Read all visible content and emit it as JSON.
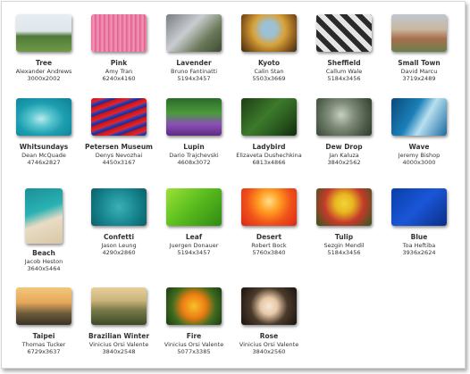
{
  "wallpapers": [
    {
      "name": "Tree",
      "author": "Alexander Andrews",
      "dims": "3000x2002",
      "bg": "linear-gradient(180deg,#e6eef4 0%,#dfe7ec 45%,#4f7a3a 58%,#6f9a46 100%)"
    },
    {
      "name": "Pink",
      "author": "Amy Tran",
      "dims": "6240x4160",
      "bg": "repeating-linear-gradient(90deg,#e86a97 0px,#f39ab9 3px,#d65485 5px)"
    },
    {
      "name": "Lavender",
      "author": "Bruno Fantinatti",
      "dims": "5194x3457",
      "bg": "linear-gradient(135deg,#7a7d84 0%,#c9cdd1 40%,#6c7a5a 70%,#3d4a32 100%)"
    },
    {
      "name": "Kyoto",
      "author": "Calin Stan",
      "dims": "5503x3669",
      "bg": "radial-gradient(circle at 50% 40%,#9cc1d6 0%,#9cc1d6 20%,#d9a23a 45%,#8a5a1c 75%,#3a2a12 100%)"
    },
    {
      "name": "Sheffield",
      "author": "Callum Wale",
      "dims": "5184x3456",
      "bg": "repeating-linear-gradient(45deg,#2a2a2a 0px,#2a2a2a 6px,#e5e5e5 6px,#e5e5e5 12px)"
    },
    {
      "name": "Small Town",
      "author": "David Marcu",
      "dims": "3719x2489",
      "bg": "linear-gradient(180deg,#bfc8cf 0%,#c9b7a0 40%,#a86f4e 65%,#6a7f4b 100%)"
    },
    {
      "name": "Whitsundays",
      "author": "Dean McQuade",
      "dims": "4746x2827",
      "bg": "radial-gradient(ellipse at 45% 55%,#bfe9ee 0%,#5cc6cf 25%,#1c9eb0 55%,#0f7f95 100%)"
    },
    {
      "name": "Petersen Museum",
      "author": "Denys Nevozhai",
      "dims": "4450x3167",
      "bg": "repeating-linear-gradient(160deg,#c0141c 0px,#e5232c 5px,#2d3fb3 7px,#1c2a8a 10px)"
    },
    {
      "name": "Lupin",
      "author": "Dario Trajchevski",
      "dims": "4608x3072",
      "bg": "linear-gradient(180deg,#2c6a2a 0%,#4b9b3b 40%,#8a4fb8 70%,#5d2c80 100%)"
    },
    {
      "name": "Ladybird",
      "author": "Elizaveta Dushechkina",
      "dims": "6813x4866",
      "bg": "linear-gradient(135deg,#1f3e17 0%,#3c7a2a 45%,#2a5a1f 70%,#132a0e 100%)"
    },
    {
      "name": "Dew Drop",
      "author": "Jan Kaluza",
      "dims": "3840x2562",
      "bg": "radial-gradient(circle at 45% 45%,#c9d0c2 0%,#7f8c78 35%,#4e5c4a 70%,#2e3a2c 100%)"
    },
    {
      "name": "Wave",
      "author": "Jeremy Bishop",
      "dims": "4000x3000",
      "bg": "linear-gradient(120deg,#0b4a7a 0%,#1b7fb8 40%,#b8e0f0 60%,#1c6aa0 100%)"
    },
    {
      "name": "Beach",
      "author": "Jacob Heston",
      "dims": "3640x5464",
      "bg": "linear-gradient(160deg,#1a8f96 0%,#2ab2b3 40%,#e8dcc4 60%,#d9c7a5 100%)",
      "portrait": true
    },
    {
      "name": "Confetti",
      "author": "Jason Leung",
      "dims": "4290x2860",
      "bg": "radial-gradient(circle at 50% 50%,#3ab0b7 0%,#14818b 60%,#0d5f67 100%)"
    },
    {
      "name": "Leaf",
      "author": "Juergen Donauer",
      "dims": "5194x3457",
      "bg": "linear-gradient(135deg,#9ee03a 0%,#5cbf1e 45%,#2f8a13 100%)"
    },
    {
      "name": "Desert",
      "author": "Robert Bock",
      "dims": "5760x3840",
      "bg": "radial-gradient(circle at 50% 35%,#ffe08a 0%,#ff9a1f 30%,#f0521a 60%,#d9281a 100%)"
    },
    {
      "name": "Tulip",
      "author": "Sezgin Mendil",
      "dims": "5184x3456",
      "bg": "radial-gradient(circle at 50% 40%,#f4d23a 0%,#e8b820 25%,#c43a2a 55%,#2f5a1f 100%)"
    },
    {
      "name": "Blue",
      "author": "Toa Heftiba",
      "dims": "3936x2624",
      "bg": "linear-gradient(135deg,#0a3fa8 0%,#1a56d8 50%,#0a2f86 100%)"
    },
    {
      "name": "Taipei",
      "author": "Thomas Tucker",
      "dims": "6729x3637",
      "bg": "linear-gradient(180deg,#f2c77a 0%,#e6a85a 40%,#6a5a3a 70%,#3a3226 100%)"
    },
    {
      "name": "Brazilian Winter",
      "author": "Vinicius Orsi Valente",
      "dims": "3840x2548",
      "bg": "linear-gradient(180deg,#e6cf9a 0%,#cbb47c 35%,#7a7a4a 60%,#3c4a28 100%)"
    },
    {
      "name": "Fire",
      "author": "Vinicius Orsi Valente",
      "dims": "5077x3385",
      "bg": "radial-gradient(circle at 50% 50%,#f7c22a 0%,#ee7d12 35%,#3e6b20 65%,#1f3a12 100%)"
    },
    {
      "name": "Rose",
      "author": "Vinicius Orsi Valente",
      "dims": "3840x2560",
      "bg": "radial-gradient(circle at 50% 50%,#f5e8d8 0%,#e8c8a8 25%,#4a3a2a 55%,#1a1410 100%)"
    }
  ]
}
